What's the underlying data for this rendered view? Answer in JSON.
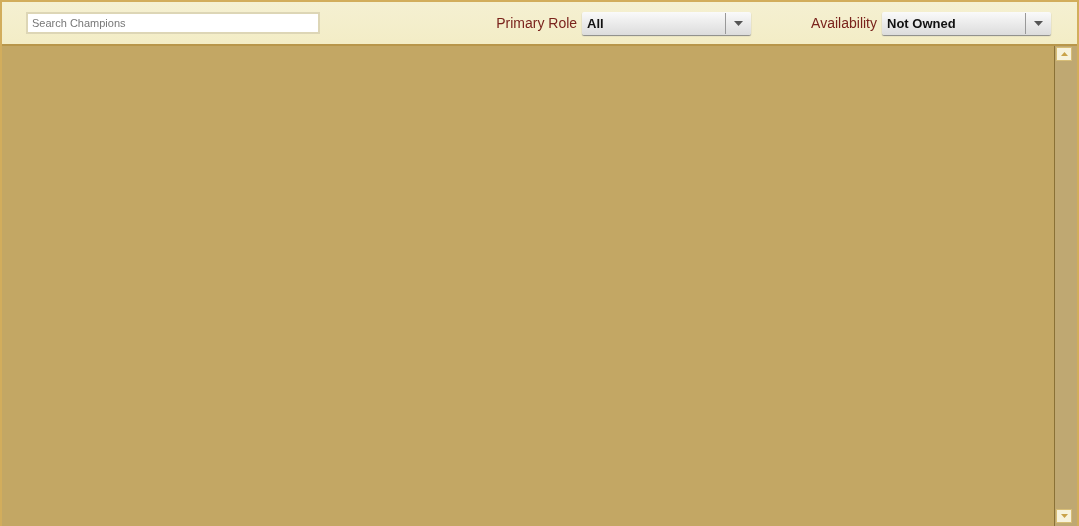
{
  "search": {
    "placeholder": "Search Champions"
  },
  "filters": [
    {
      "label": "Primary Role",
      "value": "All"
    },
    {
      "label": "Availability",
      "value": "Not Owned"
    }
  ]
}
